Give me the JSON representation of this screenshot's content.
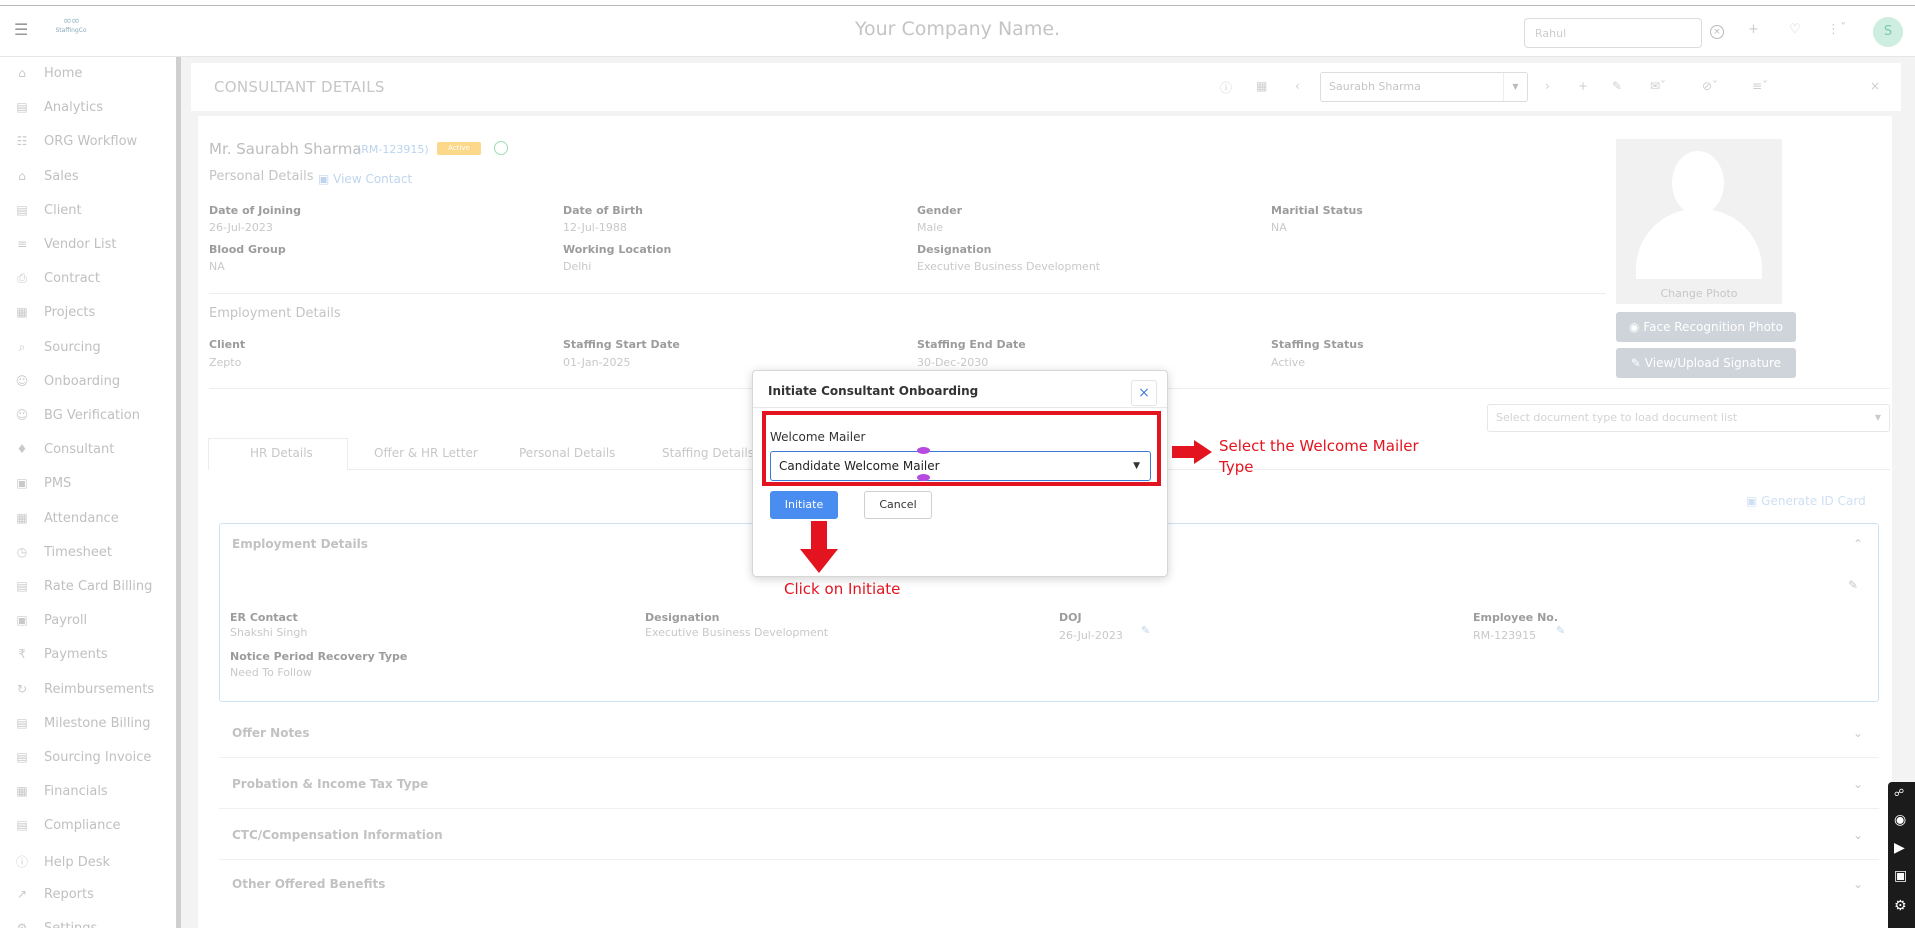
{
  "topbar": {
    "company": "Your Company Name.",
    "search_value": "Rahul",
    "avatar_initial": "S"
  },
  "sidebar": {
    "items": [
      {
        "label": "Home",
        "icon": "home-icon"
      },
      {
        "label": "Analytics",
        "icon": "analytics-icon"
      },
      {
        "label": "ORG Workflow",
        "icon": "workflow-icon"
      },
      {
        "label": "Sales",
        "icon": "sales-icon"
      },
      {
        "label": "Client",
        "icon": "client-icon"
      },
      {
        "label": "Vendor List",
        "icon": "vendor-icon"
      },
      {
        "label": "Contract",
        "icon": "contract-icon"
      },
      {
        "label": "Projects",
        "icon": "projects-icon"
      },
      {
        "label": "Sourcing",
        "icon": "sourcing-icon"
      },
      {
        "label": "Onboarding",
        "icon": "onboarding-icon"
      },
      {
        "label": "BG Verification",
        "icon": "bg-verification-icon"
      },
      {
        "label": "Consultant",
        "icon": "consultant-icon"
      },
      {
        "label": "PMS",
        "icon": "pms-icon"
      },
      {
        "label": "Attendance",
        "icon": "attendance-icon"
      },
      {
        "label": "Timesheet",
        "icon": "timesheet-icon"
      },
      {
        "label": "Rate Card Billing",
        "icon": "rate-card-icon"
      },
      {
        "label": "Payroll",
        "icon": "payroll-icon"
      },
      {
        "label": "Payments",
        "icon": "rupee-icon"
      },
      {
        "label": "Reimbursements",
        "icon": "reimbursements-icon"
      },
      {
        "label": "Milestone Billing",
        "icon": "milestone-icon"
      },
      {
        "label": "Sourcing Invoice",
        "icon": "invoice-icon"
      },
      {
        "label": "Financials",
        "icon": "financials-icon"
      },
      {
        "label": "Compliance",
        "icon": "compliance-icon"
      },
      {
        "label": "Help Desk",
        "icon": "help-icon"
      },
      {
        "label": "Reports",
        "icon": "reports-icon"
      },
      {
        "label": "Settings",
        "icon": "settings-icon"
      }
    ]
  },
  "header": {
    "title": "CONSULTANT DETAILS",
    "consultant_select": "Saurabh Sharma"
  },
  "profile": {
    "name": "Mr. Saurabh Sharma",
    "id": "(RM-123915)",
    "badge": "Active",
    "personal_details": "Personal Details",
    "view_contact": "View Contact",
    "change_photo": "Change Photo",
    "face_btn": "Face Recognition Photo",
    "sign_btn": "View/Upload Signature",
    "fields": [
      {
        "label": "Date of Joining",
        "value": "26-Jul-2023"
      },
      {
        "label": "Date of Birth",
        "value": "12-Jul-1988"
      },
      {
        "label": "Gender",
        "value": "Male"
      },
      {
        "label": "Maritial Status",
        "value": "NA"
      },
      {
        "label": "Blood Group",
        "value": "NA"
      },
      {
        "label": "Working Location",
        "value": "Delhi"
      },
      {
        "label": "Designation",
        "value": "Executive Business Development"
      }
    ],
    "employment_details": "Employment Details",
    "emp_fields": [
      {
        "label": "Client",
        "value": "Zepto"
      },
      {
        "label": "Staffing Start Date",
        "value": "01-Jan-2025"
      },
      {
        "label": "Staffing End Date",
        "value": "30-Dec-2030"
      },
      {
        "label": "Staffing Status",
        "value": "Active"
      }
    ]
  },
  "documents": {
    "placeholder": "Select document type to load document list"
  },
  "tabs": [
    "HR Details",
    "Offer & HR Letter",
    "Personal Details",
    "Staffing Details"
  ],
  "generate_id": "Generate ID Card",
  "emp_panel": {
    "title": "Employment Details",
    "fields": [
      {
        "label": "ER Contact",
        "value": "Shakshi Singh"
      },
      {
        "label": "Designation",
        "value": "Executive Business Development"
      },
      {
        "label": "DOJ",
        "value": "26-Jul-2023"
      },
      {
        "label": "Employee No.",
        "value": "RM-123915"
      },
      {
        "label": "Notice Period Recovery Type",
        "value": "Need To Follow"
      }
    ]
  },
  "accordions": [
    "Offer Notes",
    "Probation & Income Tax Type",
    "CTC/Compensation Information",
    "Other Offered Benefits"
  ],
  "modal": {
    "title": "Initiate Consultant Onboarding",
    "close": "×",
    "label": "Welcome Mailer",
    "selected": "Candidate Welcome Mailer",
    "initiate": "Initiate",
    "cancel": "Cancel"
  },
  "annotations": {
    "select_note_1": "Select the Welcome Mailer",
    "select_note_2": "Type",
    "click_note": "Click on Initiate",
    "color": "#e3141f"
  },
  "colors": {
    "accent": "#4a8df0",
    "highlight": "#e3141f",
    "avatar_bg": "#cdeee0"
  }
}
